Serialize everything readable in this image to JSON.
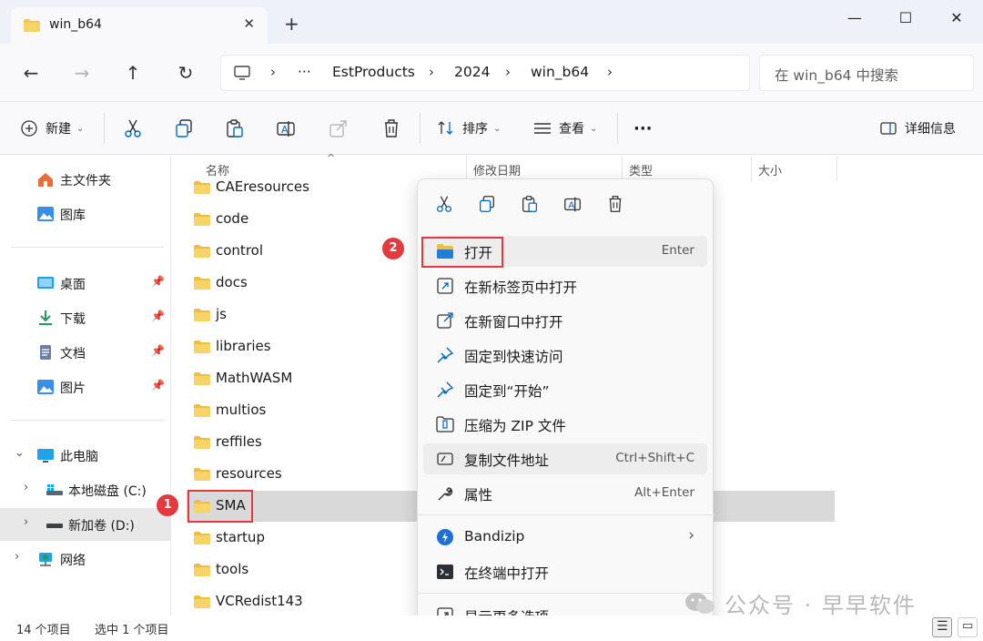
{
  "window": {
    "tab_title": "win_b64",
    "close_tab": "✕",
    "new_tab": "+",
    "minimize": "—",
    "maximize": "☐",
    "close": "✕"
  },
  "address": {
    "crumbs": [
      "···",
      "EstProducts",
      "2024",
      "win_b64"
    ],
    "search_placeholder": "在 win_b64 中搜索"
  },
  "toolbar": {
    "new_label": "新建",
    "sort_label": "排序",
    "view_label": "查看",
    "more_label": "···",
    "details_label": "详细信息"
  },
  "sidebar": {
    "items": [
      {
        "label": "主文件夹",
        "icon": "home-icon"
      },
      {
        "label": "图库",
        "icon": "gallery-icon"
      },
      {
        "label": "桌面",
        "icon": "desktop-icon"
      },
      {
        "label": "下载",
        "icon": "download-icon"
      },
      {
        "label": "文档",
        "icon": "document-icon"
      },
      {
        "label": "图片",
        "icon": "picture-icon"
      },
      {
        "label": "此电脑",
        "icon": "pc-icon"
      },
      {
        "label": "本地磁盘 (C:)",
        "icon": "drive-icon"
      },
      {
        "label": "新加卷 (D:)",
        "icon": "drive-icon"
      },
      {
        "label": "网络",
        "icon": "network-icon"
      }
    ]
  },
  "columns": {
    "name": "名称",
    "modified": "修改日期",
    "type": "类型",
    "size": "大小"
  },
  "files": [
    "CAEresources",
    "code",
    "control",
    "docs",
    "js",
    "libraries",
    "MathWASM",
    "multios",
    "reffiles",
    "resources",
    "SMA",
    "startup",
    "tools",
    "VCRedist143"
  ],
  "context_menu": {
    "items": [
      {
        "label": "打开",
        "shortcut": "Enter"
      },
      {
        "label": "在新标签页中打开",
        "shortcut": ""
      },
      {
        "label": "在新窗口中打开",
        "shortcut": ""
      },
      {
        "label": "固定到快速访问",
        "shortcut": ""
      },
      {
        "label": "固定到“开始”",
        "shortcut": ""
      },
      {
        "label": "压缩为 ZIP 文件",
        "shortcut": ""
      },
      {
        "label": "复制文件地址",
        "shortcut": "Ctrl+Shift+C"
      },
      {
        "label": "属性",
        "shortcut": "Alt+Enter"
      },
      {
        "label": "Bandizip",
        "shortcut": "›"
      },
      {
        "label": "在终端中打开",
        "shortcut": ""
      },
      {
        "label": "显示更多选项",
        "shortcut": ""
      }
    ]
  },
  "annotations": {
    "badge_1": "1",
    "badge_2": "2"
  },
  "status": {
    "item_count": "14 个项目",
    "selected": "选中 1 个项目"
  },
  "watermark": "公众号 · 早早软件",
  "colors": {
    "accent": "#0067c0",
    "folder": "#f4c84e",
    "highlight_red": "#e0393e"
  }
}
